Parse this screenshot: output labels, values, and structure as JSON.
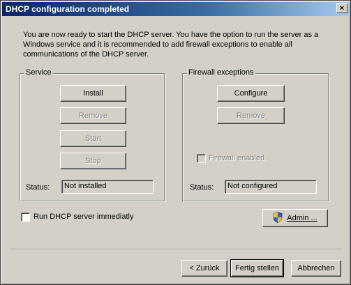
{
  "window": {
    "title": "DHCP configuration completed",
    "close_glyph": "×"
  },
  "description": "You are now ready to start the DHCP server. You have the option to run the server as a Windows service and it is recommended to add firewall exceptions to enable all communications of the DHCP server.",
  "service": {
    "legend": "Service",
    "install_label": "Install",
    "remove_label": "Remove",
    "start_label": "Start",
    "stop_label": "Stop",
    "status_label": "Status:",
    "status_value": "Not installed"
  },
  "firewall": {
    "legend": "Firewall exceptions",
    "configure_label": "Configure",
    "remove_label": "Remove",
    "enabled_label": "Firewall enabled",
    "enabled_checked": false,
    "status_label": "Status:",
    "status_value": "Not configured"
  },
  "run_immediately": {
    "label": "Run DHCP server immediatly",
    "checked": false
  },
  "admin_button": {
    "label": "Admin ...",
    "icon": "uac-shield-icon"
  },
  "footer": {
    "back_label": "< Zurück",
    "finish_label": "Fertig stellen",
    "cancel_label": "Abbrechen"
  }
}
